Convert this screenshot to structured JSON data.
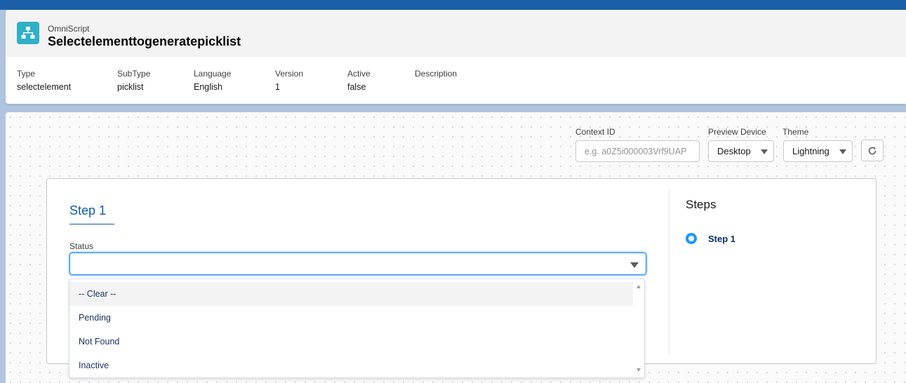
{
  "header": {
    "object_label": "OmniScript",
    "title": "Selectelementtogeneratepicklist",
    "fields": [
      {
        "label": "Type",
        "value": "selectelement"
      },
      {
        "label": "SubType",
        "value": "picklist"
      },
      {
        "label": "Language",
        "value": "English"
      },
      {
        "label": "Version",
        "value": "1"
      },
      {
        "label": "Active",
        "value": "false"
      },
      {
        "label": "Description",
        "value": ""
      }
    ]
  },
  "toolbar": {
    "context_id_label": "Context ID",
    "context_id_placeholder": "e.g. a0Z5i000003Vrf9UAP",
    "preview_device_label": "Preview Device",
    "preview_device_value": "Desktop",
    "theme_label": "Theme",
    "theme_value": "Lightning",
    "refresh_icon": "refresh-icon"
  },
  "preview": {
    "step_title": "Step 1",
    "status_label": "Status",
    "status_value": "",
    "dropdown_options": [
      "-- Clear --",
      "Pending",
      "Not Found",
      "Inactive"
    ],
    "active_option": "-- Clear --",
    "steps_title": "Steps",
    "steps": [
      "Step 1"
    ]
  },
  "colors": {
    "accent": "#0b5cab",
    "focus_ring": "#1b96ff",
    "app_icon_bg": "#2fb0c6",
    "top_band": "#1b5fa8"
  }
}
